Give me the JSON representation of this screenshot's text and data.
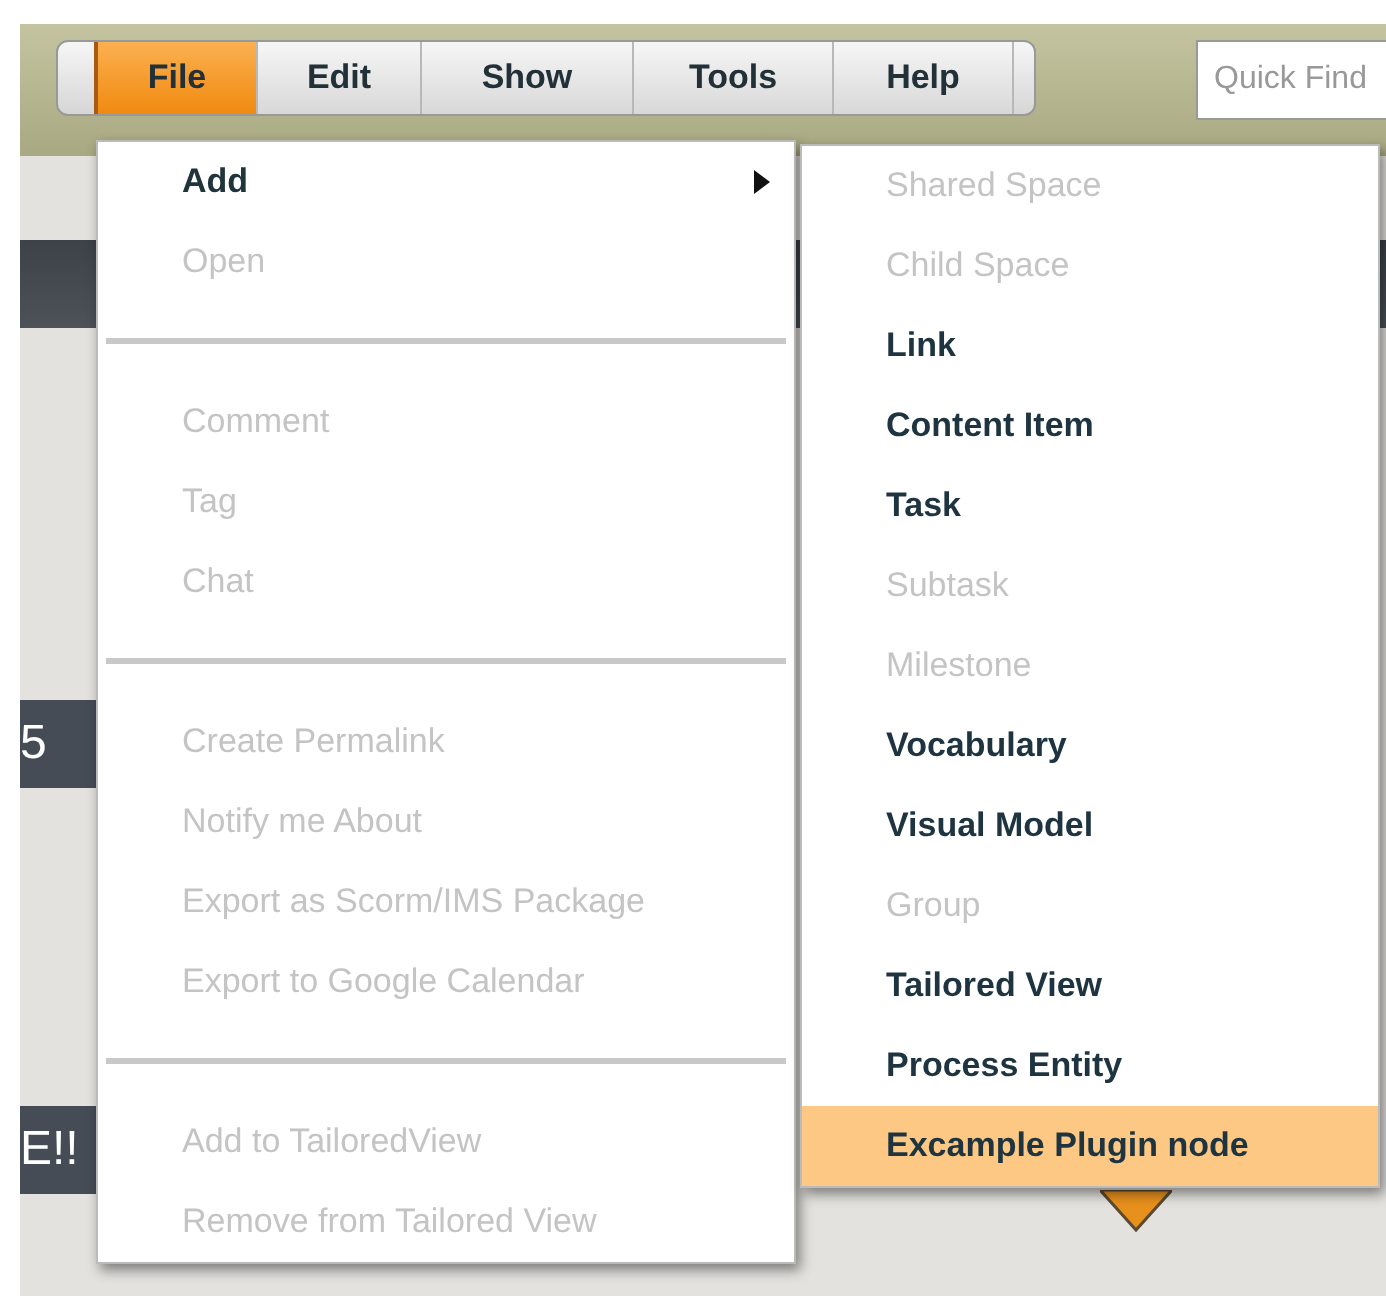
{
  "menubar": {
    "menus": [
      {
        "label": "File",
        "selected": true
      },
      {
        "label": "Edit",
        "selected": false
      },
      {
        "label": "Show",
        "selected": false
      },
      {
        "label": "Tools",
        "selected": false
      },
      {
        "label": "Help",
        "selected": false
      }
    ]
  },
  "quick_find": {
    "placeholder": "Quick Find"
  },
  "canvas_nodes": [
    {
      "label": "5"
    },
    {
      "label": "E!!"
    }
  ],
  "file_menu": {
    "items": [
      {
        "kind": "item",
        "label": "Add",
        "disabled": false,
        "submenu": true
      },
      {
        "kind": "item",
        "label": "Open",
        "disabled": true,
        "submenu": false
      },
      {
        "kind": "separator"
      },
      {
        "kind": "item",
        "label": "Comment",
        "disabled": true,
        "submenu": false
      },
      {
        "kind": "item",
        "label": "Tag",
        "disabled": true,
        "submenu": false
      },
      {
        "kind": "item",
        "label": "Chat",
        "disabled": true,
        "submenu": false
      },
      {
        "kind": "separator"
      },
      {
        "kind": "item",
        "label": "Create Permalink",
        "disabled": true,
        "submenu": false
      },
      {
        "kind": "item",
        "label": "Notify me About",
        "disabled": true,
        "submenu": false
      },
      {
        "kind": "item",
        "label": "Export as Scorm/IMS Package",
        "disabled": true,
        "submenu": false
      },
      {
        "kind": "item",
        "label": "Export to Google Calendar",
        "disabled": true,
        "submenu": false
      },
      {
        "kind": "separator"
      },
      {
        "kind": "item",
        "label": "Add to TailoredView",
        "disabled": true,
        "submenu": false
      },
      {
        "kind": "item",
        "label": "Remove from Tailored View",
        "disabled": true,
        "submenu": false
      }
    ]
  },
  "add_submenu": {
    "items": [
      {
        "label": "Shared Space",
        "disabled": true,
        "selected": false
      },
      {
        "label": "Child Space",
        "disabled": true,
        "selected": false
      },
      {
        "label": "Link",
        "disabled": false,
        "selected": false
      },
      {
        "label": "Content Item",
        "disabled": false,
        "selected": false
      },
      {
        "label": "Task",
        "disabled": false,
        "selected": false
      },
      {
        "label": "Subtask",
        "disabled": true,
        "selected": false
      },
      {
        "label": "Milestone",
        "disabled": true,
        "selected": false
      },
      {
        "label": "Vocabulary",
        "disabled": false,
        "selected": false
      },
      {
        "label": "Visual Model",
        "disabled": false,
        "selected": false
      },
      {
        "label": "Group",
        "disabled": true,
        "selected": false
      },
      {
        "label": "Tailored View",
        "disabled": false,
        "selected": false
      },
      {
        "label": "Process Entity",
        "disabled": false,
        "selected": false
      },
      {
        "label": "Excample Plugin node",
        "disabled": false,
        "selected": true
      }
    ]
  }
}
